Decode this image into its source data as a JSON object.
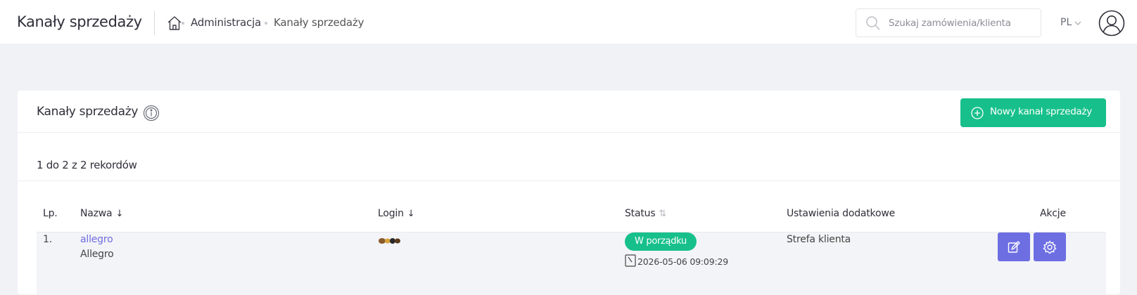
{
  "header": {
    "page_title": "Kanały sprzedaży",
    "breadcrumb": [
      "Administracja",
      "Kanały sprzedaży"
    ],
    "search_placeholder": "Szukaj zamówienia/klienta",
    "language": "PL"
  },
  "card": {
    "title": "Kanały sprzedaży",
    "new_button_label": "Nowy kanał sprzedaży",
    "records_text": "1 do 2 z 2 rekordów"
  },
  "table": {
    "columns": [
      "Lp.",
      "Nazwa",
      "Login",
      "Status",
      "Ustawienia dodatkowe",
      "Akcje"
    ],
    "sort_arrows": {
      "nazwa": "↓",
      "login": "↓",
      "status": "⇅"
    },
    "rows": [
      {
        "lp": "1.",
        "name_link": "allegro",
        "name_sub": "Allegro",
        "status": "W porządku",
        "status_time": "2026-05-06 09:09:29",
        "settings": "Strefa klienta"
      }
    ]
  },
  "colors": {
    "accent_green": "#17c08a",
    "action_purple": "#6d6ee2",
    "link": "#6e6de0"
  },
  "icons": [
    "home-icon",
    "search-icon",
    "chevron-down-icon",
    "user-avatar-icon",
    "info-icon",
    "plus-circle-icon",
    "clock-icon",
    "edit-icon",
    "gear-icon"
  ]
}
